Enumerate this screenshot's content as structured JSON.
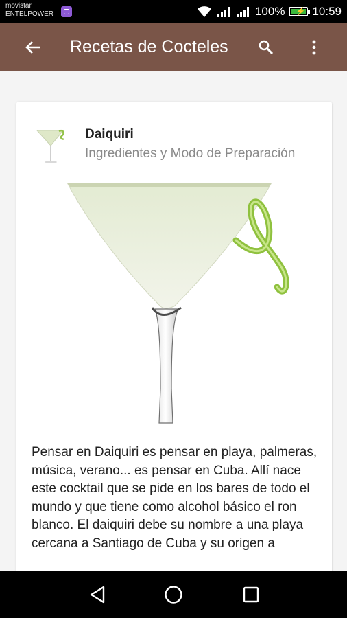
{
  "status_bar": {
    "carrier_line1": "movistar",
    "carrier_line2": "ENTELPOWER",
    "battery_percent": "100%",
    "battery_level": 1.0,
    "time": "10:59",
    "icons": [
      "notification-app-icon",
      "wifi-icon",
      "signal-icon",
      "signal-icon",
      "battery-charging-icon"
    ]
  },
  "app_bar": {
    "title": "Recetas de Cocteles",
    "background": "#7a5548",
    "icons": [
      "back-arrow-icon",
      "search-icon",
      "overflow-menu-icon"
    ]
  },
  "card": {
    "title": "Daiquiri",
    "subtitle": "Ingredientes y Modo de Preparación",
    "image": "daiquiri-cocktail-glass",
    "body": "Pensar en Daiquiri es pensar en playa, palmeras, música, verano... es pensar en Cuba. Allí nace este cocktail que se pide en los bares de todo el mundo y que tiene como alcohol básico el ron blanco. El daiquiri debe su nombre a una playa cercana a Santiago de Cuba y su origen a"
  },
  "nav_bar": {
    "icons": [
      "back-triangle-icon",
      "home-circle-icon",
      "recents-square-icon"
    ]
  }
}
